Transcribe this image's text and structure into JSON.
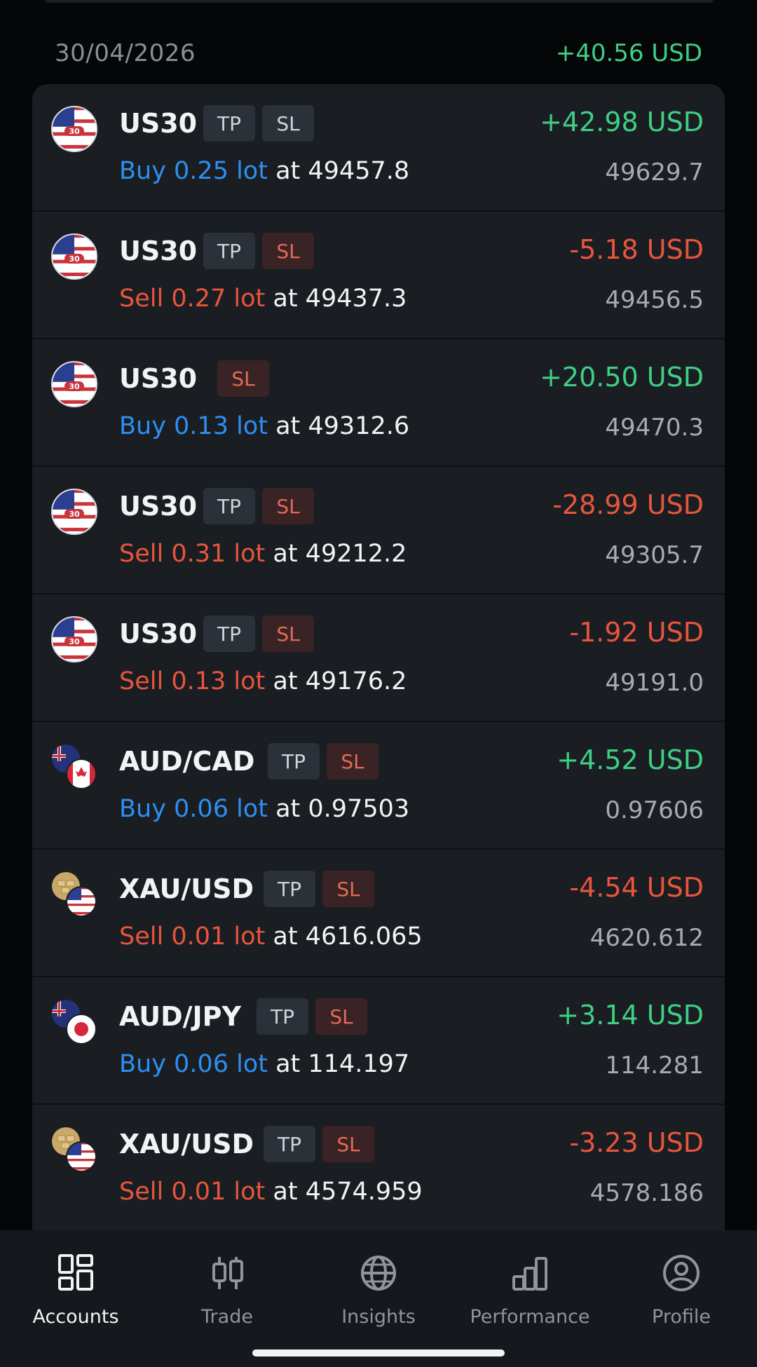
{
  "date_header": {
    "date": "30/04/2026",
    "total": "+40.56 USD"
  },
  "colors": {
    "positive": "#3fcf84",
    "negative": "#e8553c",
    "buy": "#2d8fef",
    "sell": "#e8553c",
    "card_bg": "#1a1e23",
    "page_bg": "#050607"
  },
  "positions": [
    {
      "symbol": "US30",
      "icon": "us30-flag-icon",
      "tp": "TP",
      "sl": "SL",
      "sl_active": false,
      "side": "Buy 0.25 lot",
      "side_type": "buy",
      "at": "at 49457.8",
      "pnl": "+42.98 USD",
      "pnl_type": "pos",
      "current": "49629.7"
    },
    {
      "symbol": "US30",
      "icon": "us30-flag-icon",
      "tp": "TP",
      "sl": "SL",
      "sl_active": true,
      "side": "Sell 0.27 lot",
      "side_type": "sell",
      "at": "at 49437.3",
      "pnl": "-5.18 USD",
      "pnl_type": "neg",
      "current": "49456.5"
    },
    {
      "symbol": "US30",
      "icon": "us30-flag-icon",
      "tp": "",
      "sl": "SL",
      "sl_active": true,
      "side": "Buy 0.13 lot",
      "side_type": "buy",
      "at": "at 49312.6",
      "pnl": "+20.50 USD",
      "pnl_type": "pos",
      "current": "49470.3"
    },
    {
      "symbol": "US30",
      "icon": "us30-flag-icon",
      "tp": "TP",
      "sl": "SL",
      "sl_active": true,
      "side": "Sell 0.31 lot",
      "side_type": "sell",
      "at": "at 49212.2",
      "pnl": "-28.99 USD",
      "pnl_type": "neg",
      "current": "49305.7"
    },
    {
      "symbol": "US30",
      "icon": "us30-flag-icon",
      "tp": "TP",
      "sl": "SL",
      "sl_active": true,
      "side": "Sell 0.13 lot",
      "side_type": "sell",
      "at": "at 49176.2",
      "pnl": "-1.92 USD",
      "pnl_type": "neg",
      "current": "49191.0"
    },
    {
      "symbol": "AUD/CAD",
      "icon": "aud-cad-flags-icon",
      "tp": "TP",
      "sl": "SL",
      "sl_active": true,
      "side": "Buy 0.06 lot",
      "side_type": "buy",
      "at": "at 0.97503",
      "pnl": "+4.52 USD",
      "pnl_type": "pos",
      "current": "0.97606"
    },
    {
      "symbol": "XAU/USD",
      "icon": "xau-usd-icon",
      "tp": "TP",
      "sl": "SL",
      "sl_active": true,
      "side": "Sell 0.01 lot",
      "side_type": "sell",
      "at": "at 4616.065",
      "pnl": "-4.54 USD",
      "pnl_type": "neg",
      "current": "4620.612"
    },
    {
      "symbol": "AUD/JPY",
      "icon": "aud-jpy-flags-icon",
      "tp": "TP",
      "sl": "SL",
      "sl_active": true,
      "side": "Buy 0.06 lot",
      "side_type": "buy",
      "at": "at 114.197",
      "pnl": "+3.14 USD",
      "pnl_type": "pos",
      "current": "114.281"
    },
    {
      "symbol": "XAU/USD",
      "icon": "xau-usd-icon",
      "tp": "TP",
      "sl": "SL",
      "sl_active": true,
      "side": "Sell 0.01 lot",
      "side_type": "sell",
      "at": "at 4574.959",
      "pnl": "-3.23 USD",
      "pnl_type": "neg",
      "current": "4578.186"
    }
  ],
  "nav": [
    {
      "label": "Accounts",
      "icon": "accounts-grid-icon",
      "active": true
    },
    {
      "label": "Trade",
      "icon": "candlestick-icon",
      "active": false
    },
    {
      "label": "Insights",
      "icon": "globe-icon",
      "active": false
    },
    {
      "label": "Performance",
      "icon": "bar-chart-icon",
      "active": false
    },
    {
      "label": "Profile",
      "icon": "profile-icon",
      "active": false
    }
  ]
}
